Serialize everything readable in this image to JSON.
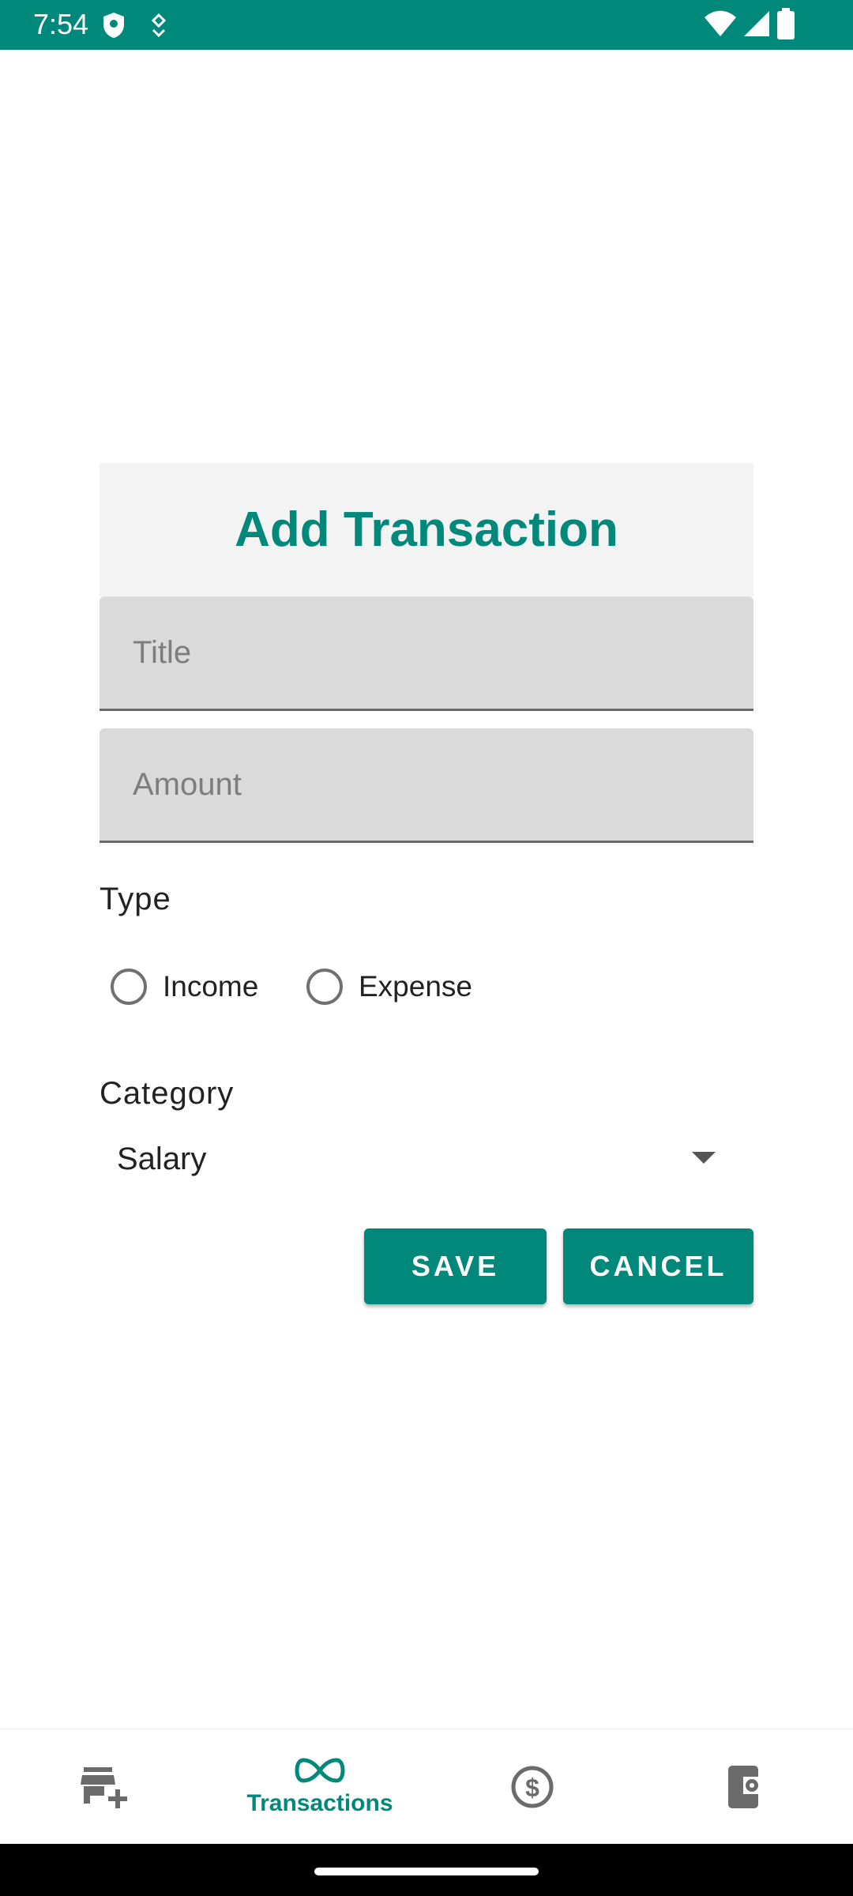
{
  "status_bar": {
    "time": "7:54",
    "icons": [
      "shield-icon",
      "notification-icon",
      "wifi-icon",
      "signal-icon",
      "battery-icon"
    ],
    "color": "#00897b"
  },
  "dialog": {
    "title": "Add Transaction",
    "title_field": {
      "placeholder": "Title",
      "value": ""
    },
    "amount_field": {
      "placeholder": "Amount",
      "value": ""
    },
    "type_label": "Type",
    "type_options": [
      "Income",
      "Expense"
    ],
    "category_label": "Category",
    "category_value": "Salary",
    "save_label": "SAVE",
    "cancel_label": "CANCEL"
  },
  "bottom_nav": {
    "items": [
      {
        "icon": "add-store-icon",
        "label": ""
      },
      {
        "icon": "infinity-icon",
        "label": "Transactions",
        "selected": true
      },
      {
        "icon": "dollar-circle-icon",
        "label": ""
      },
      {
        "icon": "phone-settings-icon",
        "label": ""
      }
    ],
    "accent": "#00897b"
  }
}
